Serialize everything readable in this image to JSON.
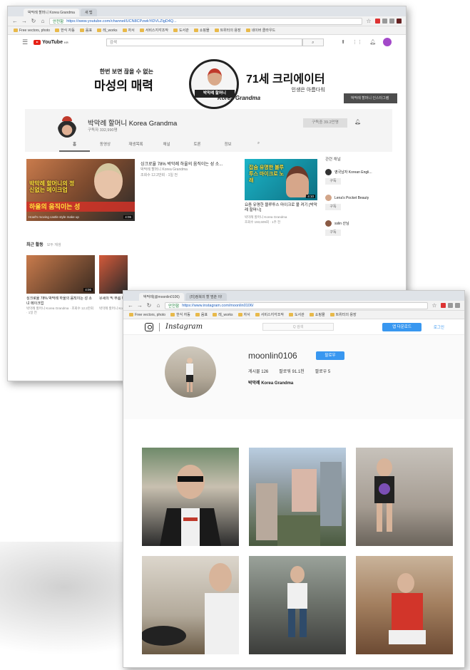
{
  "youtube_window": {
    "tabs": [
      {
        "label": "박막례 할머니 Korea Grandma"
      },
      {
        "label": "새 탭"
      }
    ],
    "address": {
      "secure_label": "안전함",
      "url": "https://www.youtube.com/channel/UCN8CPzwkYiDVLZlgD4Q..."
    },
    "bookmarks": [
      "Free vectors, photo",
      "한식 자동",
      "음표",
      "레_works",
      "자서",
      "서비스지각조작",
      "도서관",
      "쇼핑몰",
      "트위터의 용장",
      "네이버 클라우드"
    ],
    "header": {
      "logo": "YouTube",
      "logo_sup": "KR",
      "search_placeholder": "검색"
    },
    "banner": {
      "line1": "한번 보면 끊을 수 없는",
      "line2": "마성의 매력",
      "right_big": "71세 크리에이터",
      "right_small": "인생은 아름다워",
      "circle_ribbon": "박막례 할머니",
      "subtitle": "Korea Grandma",
      "link": "박막례 할머니 인스타그램"
    },
    "channel": {
      "name": "박막례 할머니 Korea Grandma",
      "subscribers": "구독자 332,990명",
      "subscribe_button": "구독중 39.2만명",
      "tabs": [
        "홈",
        "동영상",
        "재생목록",
        "채널",
        "토론",
        "정보"
      ]
    },
    "featured_video": {
      "thumb_title": "박막례 할머니의 정신없는 메이크업",
      "thumb_ribbon": "하울의 움직이는 성",
      "thumb_sub": "Howl's moving castle style make up",
      "duration": "4:06",
      "title": "싱크로율 78% 박막례 하울의 움직이는 성 소...",
      "channel": "박막례 할머니 Korea Grandma",
      "stats": "조회수 12.2만회 · 1일 전"
    },
    "second_video": {
      "thumb_text": "잡숨 유명한 블루투스 마이크로 노래",
      "duration": "4:10",
      "title": "요즘 유명한 블루투스 마이크로 불 켜기 [박막례 할머니]",
      "channel": "박막례 할머니 Korea Grandma",
      "stats": "조회수 193,609회 · 1주 전"
    },
    "sidebar": {
      "heading": "관련 채널",
      "items": [
        {
          "name": "영국남자 Korean Engli...",
          "button": "구독"
        },
        {
          "name": "Lena's Pocket Beauty",
          "button": "구독"
        },
        {
          "name": "sslin 산님",
          "button": "구독"
        }
      ]
    },
    "recent": {
      "heading": "최근 활동",
      "sub": "모두 재생",
      "items": [
        {
          "title": "싱크로율 78% 박막례 하울의 움직이는 성 소녀 메이크업",
          "meta": "박막례 할머니 Korea Grandma · 조회수 12.2만회 · 1일 전",
          "duration": "4:06"
        },
        {
          "title": "유세의 믹 부름 미...",
          "meta": "박막례 할머니 Korea Grandma · 조회수 ...",
          "duration": ""
        }
      ]
    }
  },
  "instagram_window": {
    "tabs": [
      {
        "label": "박막례(@moonlin0106)"
      },
      {
        "label": "(미)정복의 할 멈춘 이!"
      }
    ],
    "address": {
      "secure_label": "안전함",
      "url": "https://www.instagram.com/moonlin0106/"
    },
    "bookmarks": [
      "Free vectors, photo",
      "한식 자동",
      "음표",
      "레_works",
      "자서",
      "서비스지각조작",
      "도서관",
      "쇼핑몰",
      "트위터의 용장"
    ],
    "header": {
      "wordmark": "Instagram",
      "search_placeholder": "Q 검색",
      "download_button": "앱 다운로드",
      "login_link": "로그인"
    },
    "profile": {
      "username": "moonlin0106",
      "follow_button": "팔로우",
      "stats": [
        "게시물 126",
        "팔로워 91.1천",
        "팔로우 5"
      ],
      "bio": "박막례 Korea Grandma"
    },
    "posts_count_shown": 6
  },
  "colors": {
    "youtube_red": "#e62117",
    "instagram_blue": "#3897f0",
    "banner_ribbon": "#222222"
  }
}
